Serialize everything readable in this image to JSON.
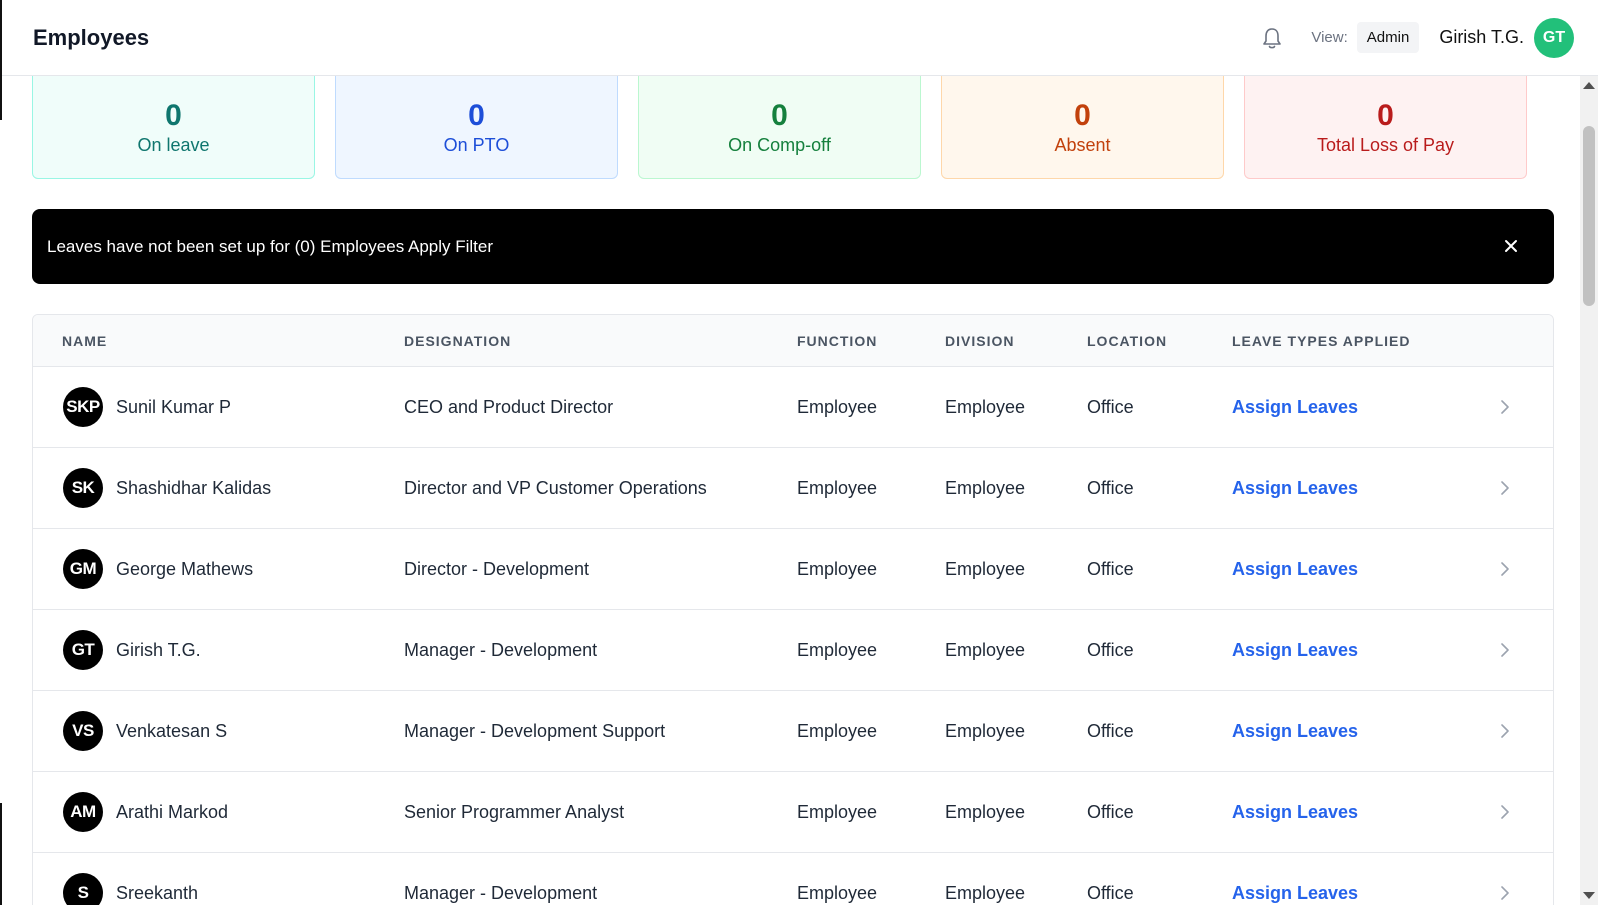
{
  "header": {
    "title": "Employees",
    "view_label": "View:",
    "view_value": "Admin",
    "user_name": "Girish T.G.",
    "user_initials": "GT",
    "user_avatar_color": "#22c07a"
  },
  "stats": [
    {
      "value": "0",
      "label": "On leave",
      "color": "#0f766e",
      "bg": "#f0fdfa",
      "border": "#99f6e4"
    },
    {
      "value": "0",
      "label": "On PTO",
      "color": "#1d4ed8",
      "bg": "#eff6ff",
      "border": "#bfdbfe"
    },
    {
      "value": "0",
      "label": "On Comp-off",
      "color": "#15803d",
      "bg": "#f0fdf4",
      "border": "#bbf7d0"
    },
    {
      "value": "0",
      "label": "Absent",
      "color": "#c2410c",
      "bg": "#fff7ed",
      "border": "#fed7aa"
    },
    {
      "value": "0",
      "label": "Total Loss of Pay",
      "color": "#b91c1c",
      "bg": "#fef2f2",
      "border": "#fecaca"
    }
  ],
  "banner": {
    "text": "Leaves have not been set up for (0) Employees Apply Filter"
  },
  "table": {
    "columns": [
      "NAME",
      "DESIGNATION",
      "FUNCTION",
      "DIVISION",
      "LOCATION",
      "LEAVE TYPES APPLIED"
    ],
    "rows": [
      {
        "initials": "SKP",
        "name": "Sunil Kumar P",
        "designation": "CEO and Product Director",
        "function": "Employee",
        "division": "Employee",
        "location": "Office",
        "action": "Assign Leaves"
      },
      {
        "initials": "SK",
        "name": "Shashidhar Kalidas",
        "designation": "Director and VP Customer Operations",
        "function": "Employee",
        "division": "Employee",
        "location": "Office",
        "action": "Assign Leaves"
      },
      {
        "initials": "GM",
        "name": "George Mathews",
        "designation": "Director - Development",
        "function": "Employee",
        "division": "Employee",
        "location": "Office",
        "action": "Assign Leaves"
      },
      {
        "initials": "GT",
        "name": "Girish T.G.",
        "designation": "Manager - Development",
        "function": "Employee",
        "division": "Employee",
        "location": "Office",
        "action": "Assign Leaves"
      },
      {
        "initials": "VS",
        "name": "Venkatesan S",
        "designation": "Manager - Development Support",
        "function": "Employee",
        "division": "Employee",
        "location": "Office",
        "action": "Assign Leaves"
      },
      {
        "initials": "AM",
        "name": "Arathi Markod",
        "designation": "Senior Programmer Analyst",
        "function": "Employee",
        "division": "Employee",
        "location": "Office",
        "action": "Assign Leaves"
      },
      {
        "initials": "S",
        "name": "Sreekanth",
        "designation": "Manager - Development",
        "function": "Employee",
        "division": "Employee",
        "location": "Office",
        "action": "Assign Leaves"
      }
    ]
  },
  "icons": {
    "bell": "bell-icon",
    "close": "close-icon",
    "chevron": "chevron-right-icon"
  },
  "colors": {
    "link": "#2563eb",
    "banner_bg": "#000000"
  }
}
